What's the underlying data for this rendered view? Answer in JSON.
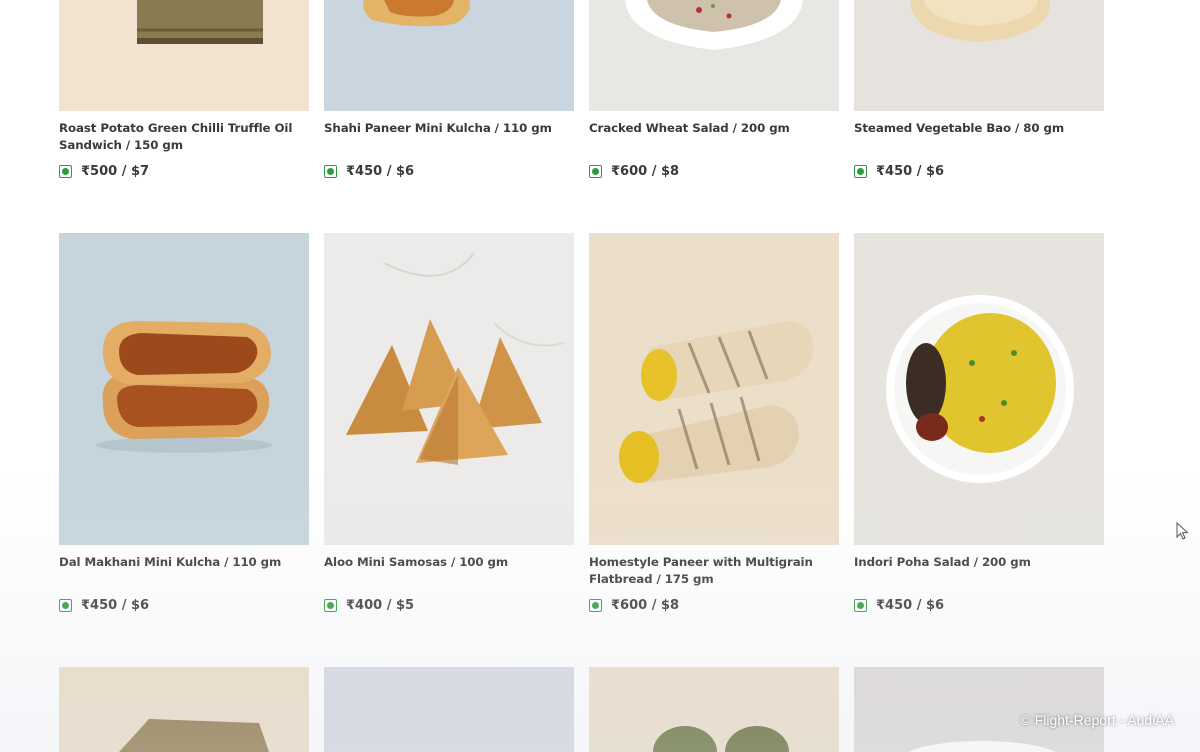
{
  "menu": {
    "rows": [
      [
        {
          "title": "Roast Potato Green Chilli Truffle Oil Sandwich / 150 gm",
          "price": "₹500 / $7",
          "veg": true,
          "image": "sandwich"
        },
        {
          "title": "Shahi Paneer Mini Kulcha / 110 gm",
          "price": "₹450 / $6",
          "veg": true,
          "image": "kulcha"
        },
        {
          "title": "Cracked Wheat Salad / 200 gm",
          "price": "₹600 / $8",
          "veg": true,
          "image": "wheat-salad"
        },
        {
          "title": "Steamed Vegetable Bao / 80 gm",
          "price": "₹450 / $6",
          "veg": true,
          "image": "bao"
        }
      ],
      [
        {
          "title": "Dal Makhani Mini Kulcha / 110 gm",
          "price": "₹450 / $6",
          "veg": true,
          "image": "dal-kulcha"
        },
        {
          "title": "Aloo Mini Samosas / 100 gm",
          "price": "₹400 / $5",
          "veg": true,
          "image": "samosas"
        },
        {
          "title": "Homestyle Paneer with Multigrain Flatbread / 175 gm",
          "price": "₹600 / $8",
          "veg": true,
          "image": "wrap"
        },
        {
          "title": "Indori Poha Salad / 200 gm",
          "price": "₹450 / $6",
          "veg": true,
          "image": "poha"
        }
      ]
    ]
  },
  "colors": {
    "veg_indicator": "#2a9d3a",
    "text": "#3a3a3a"
  },
  "watermark": "© Flight-Report - AudiAA"
}
